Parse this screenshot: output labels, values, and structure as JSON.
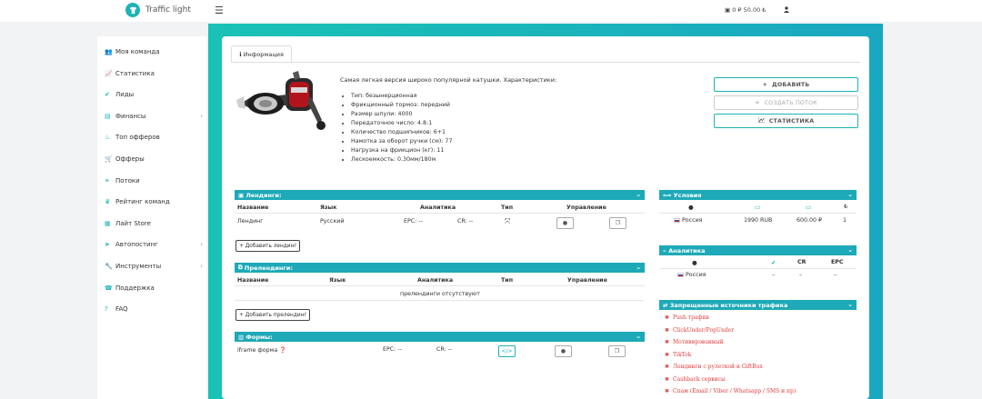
{
  "topbar": {
    "logo_text": "Traffic light",
    "balance": "0 ₽ 50.00 ₺",
    "icons": [
      "menu-icon",
      "wallet-icon",
      "user-icon"
    ]
  },
  "sidebar": {
    "items": [
      {
        "label": "Моя команда",
        "icon": "team-icon",
        "has_submenu": false
      },
      {
        "label": "Статистика",
        "icon": "chart-icon",
        "has_submenu": false
      },
      {
        "label": "Лиды",
        "icon": "check-icon",
        "has_submenu": false
      },
      {
        "label": "Финансы",
        "icon": "money-icon",
        "has_submenu": true
      },
      {
        "label": "Топ офферов",
        "icon": "fire-icon",
        "has_submenu": false
      },
      {
        "label": "Офферы",
        "icon": "cart-icon",
        "has_submenu": false
      },
      {
        "label": "Потоки",
        "icon": "link-icon",
        "has_submenu": false
      },
      {
        "label": "Рейтинг команд",
        "icon": "trophy-icon",
        "has_submenu": false
      },
      {
        "label": "Лайт Store",
        "icon": "store-icon",
        "has_submenu": false
      },
      {
        "label": "Автопостинг",
        "icon": "send-icon",
        "has_submenu": true
      },
      {
        "label": "Инструменты",
        "icon": "wrench-icon",
        "has_submenu": true
      },
      {
        "label": "Поддержка",
        "icon": "support-icon",
        "has_submenu": false
      },
      {
        "label": "FAQ",
        "icon": "question-icon",
        "has_submenu": false
      }
    ],
    "submenu_glyph": "›"
  },
  "tab": {
    "label": "Информация",
    "icon": "info-icon"
  },
  "product": {
    "intro": "Самая легкая версия широко популярной катушки. Характеристики:",
    "specs": [
      "Тип: безынерционная",
      "Фрикционный тормоз: передний",
      "Размер шпули: 4000",
      "Передаточное число: 4.8:1",
      "Количество подшипников: 6+1",
      "Намотка за оборот ручки (см): 77",
      "Нагрузка на фрикцион (кг): 11",
      "Лескоемкость: 0.30мм/180м"
    ]
  },
  "actions": {
    "add": "ДОБАВИТЬ",
    "create_stream": "СОЗДАТЬ ПОТОК",
    "stats": "СТАТИСТИКА"
  },
  "landings": {
    "title": "Лендинги:",
    "columns": [
      "Название",
      "Язык",
      "Аналитика",
      "Тип",
      "Управление"
    ],
    "row": {
      "name": "Лендинг",
      "lang": "Русский",
      "epc": "EPC: --",
      "cr": "CR: --"
    },
    "add_button": "Добавить лендинг"
  },
  "prelandings": {
    "title": "Прелендинги:",
    "columns": [
      "Название",
      "Язык",
      "Аналитика",
      "Тип",
      "Управление"
    ],
    "empty": "прелендинги отсутствуют",
    "add_button": "Добавить прелендинг"
  },
  "forms": {
    "title": "Формы:",
    "row": {
      "name": "iframe форма",
      "epc": "EPC: --",
      "cr": "CR: --"
    }
  },
  "conditions": {
    "title": "Условия",
    "row": {
      "country": "Россия",
      "price": "1990 RUB",
      "payout": "600.00 ₽",
      "hold": "1"
    }
  },
  "analytics": {
    "title": "Аналитика",
    "columns": [
      "CR",
      "EPC"
    ],
    "row": {
      "country": "Россия",
      "approve": "–",
      "cr": "–",
      "epc": "–"
    }
  },
  "forbidden": {
    "title": "Запрещенные источники трафика",
    "items": [
      "Push трафик",
      "ClickUnder/PopUnder",
      "Мотивированный",
      "TikTok",
      "Лендинги с рулеткой и GiftBox",
      "Cashback сервисы",
      "Спам (Email / Viber / Whatsapp / SMS и пр)"
    ]
  },
  "colors": {
    "accent": "#1cb2b8",
    "header": "#1ea9b8",
    "danger": "#e23b3b"
  }
}
